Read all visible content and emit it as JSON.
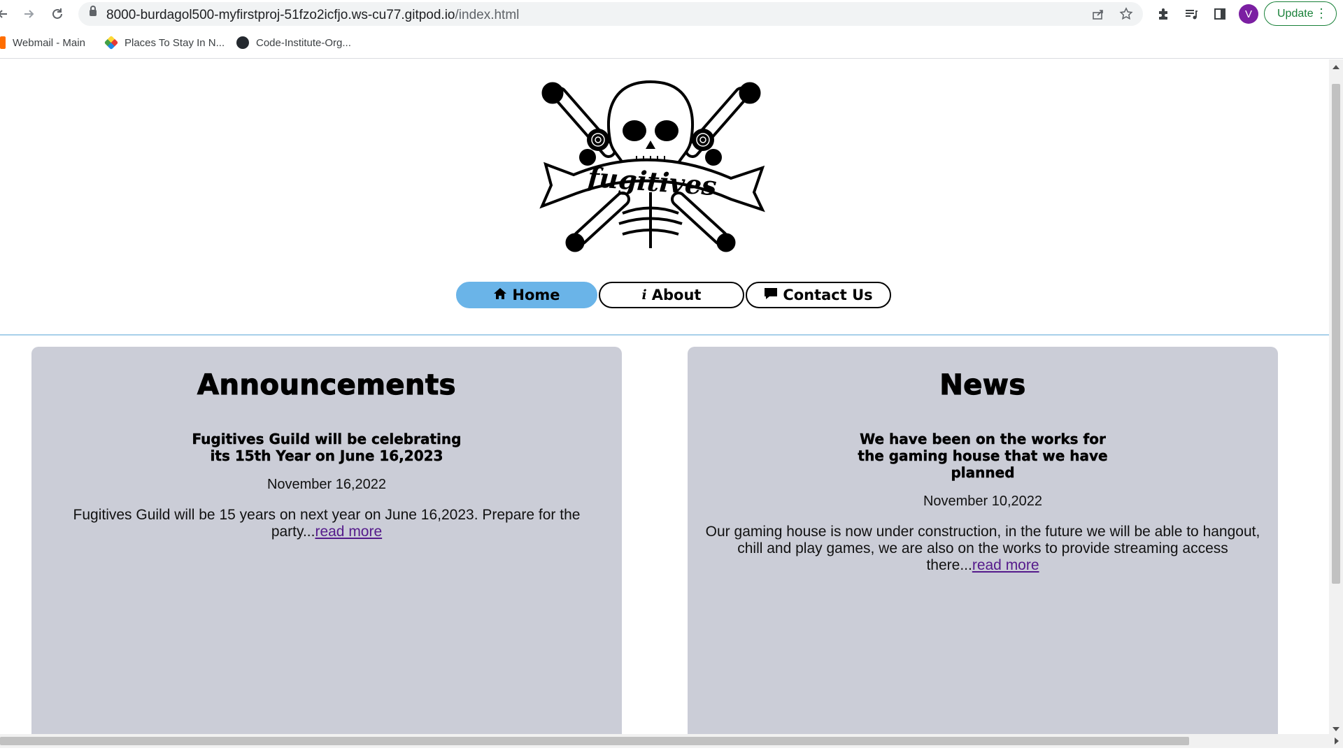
{
  "browser": {
    "url_host": "8000-burdagol500-myfirstproj-51fzo2icfjo.ws-cu77.gitpod.io",
    "url_path": "/index.html",
    "profile_initial": "V",
    "update_label": "Update",
    "bookmarks": [
      {
        "label": "Webmail - Main",
        "icon": "webmail-icon"
      },
      {
        "label": "Places To Stay In N...",
        "icon": "places-icon"
      },
      {
        "label": "Code-Institute-Org...",
        "icon": "github-icon"
      }
    ]
  },
  "site": {
    "logo_text": "fugitives",
    "nav": {
      "home": "Home",
      "about": "About",
      "contact": "Contact Us",
      "home_icon": "house-icon",
      "about_icon": "info-icon",
      "contact_icon": "comment-icon"
    },
    "announcements": {
      "heading": "Announcements",
      "title_line1": "Fugitives Guild will be celebrating",
      "title_line2": "its 15th Year on June 16,2023",
      "date": "November 16,2022",
      "body": "Fugitives Guild will be 15 years on next year on June 16,2023. Prepare for the party...",
      "link": "read more"
    },
    "news": {
      "heading": "News",
      "title": "We have been on the works for the gaming house that we have planned",
      "date": "November 10,2022",
      "body": "Our gaming house is now under construction, in the future we will be able to hangout, chill and play games, we are also on the works to provide streaming access there...",
      "link": "read more"
    }
  },
  "colors": {
    "nav_active": "#6ab4e8",
    "card_bg": "#cbcdd7",
    "divider": "#a8d0ea",
    "update_green": "#188038",
    "avatar": "#7b1fa2"
  }
}
